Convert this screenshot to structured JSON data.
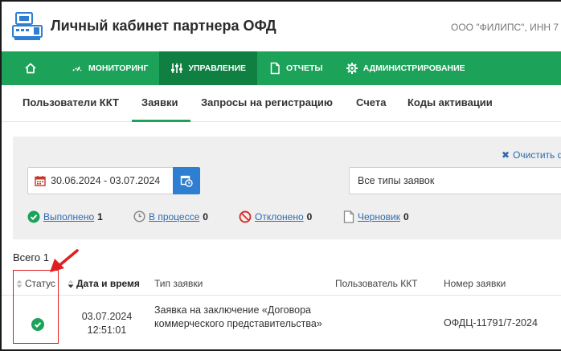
{
  "header": {
    "title": "Личный кабинет партнера ОФД",
    "org": "ООО \"ФИЛИПС\", ИНН 7"
  },
  "nav": {
    "items": [
      {
        "label": "",
        "icon": "home-icon"
      },
      {
        "label": "МОНИТОРИНГ",
        "icon": "gauge-icon"
      },
      {
        "label": "УПРАВЛЕНИЕ",
        "icon": "sliders-icon",
        "active": true
      },
      {
        "label": "ОТЧЕТЫ",
        "icon": "document-icon"
      },
      {
        "label": "АДМИНИСТРИРОВАНИЕ",
        "icon": "gear-icon"
      }
    ]
  },
  "tabs": [
    {
      "label": "Пользователи ККТ"
    },
    {
      "label": "Заявки",
      "active": true
    },
    {
      "label": "Запросы на регистрацию"
    },
    {
      "label": "Счета"
    },
    {
      "label": "Коды активации"
    }
  ],
  "filters": {
    "clear_label": "Очистить ф",
    "date_range": "30.06.2024 - 03.07.2024",
    "type_select": "Все типы заявок",
    "statuses": [
      {
        "label": "Выполнено",
        "count": "1",
        "icon": "check-circle-icon",
        "color": "#1da25a"
      },
      {
        "label": "В процессе",
        "count": "0",
        "icon": "clock-icon",
        "color": "#888888"
      },
      {
        "label": "Отклонено",
        "count": "0",
        "icon": "ban-icon",
        "color": "#d9302c"
      },
      {
        "label": "Черновик",
        "count": "0",
        "icon": "draft-icon",
        "color": "#888888"
      }
    ]
  },
  "table": {
    "total": "Всего 1",
    "columns": [
      "Статус",
      "Дата и время",
      "Тип заявки",
      "Пользователь ККТ",
      "Номер заявки"
    ],
    "rows": [
      {
        "status_icon": "check-circle-icon",
        "date": "03.07.2024",
        "time": "12:51:01",
        "type": "Заявка на заключение «Договора коммерческого представительства»",
        "user": "",
        "number": "ОФДЦ-11791/7-2024"
      }
    ]
  },
  "colors": {
    "brand_green": "#1da25a",
    "nav_active": "#0f7f42",
    "link_blue": "#2d6ab0",
    "button_blue": "#2e7fd1",
    "annotation_red": "#e02020"
  }
}
